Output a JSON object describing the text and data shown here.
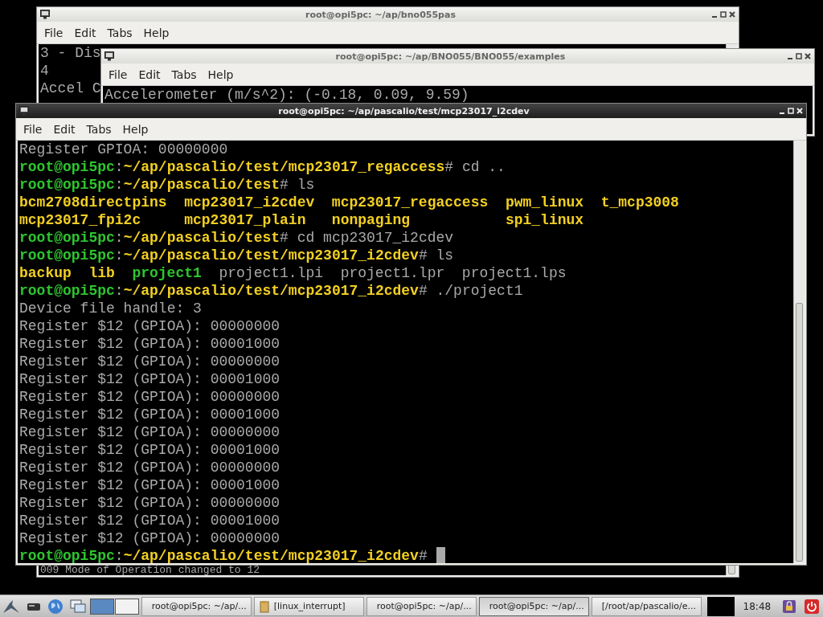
{
  "windows": [
    {
      "title": "root@opi5pc: ~/ap/bno055pas",
      "active": false,
      "menu": [
        "File",
        "Edit",
        "Tabs",
        "Help"
      ],
      "lines": [
        {
          "segments": [
            {
              "kind": "plain",
              "text": "3 - Dis"
            }
          ]
        },
        {
          "segments": [
            {
              "kind": "plain",
              "text": "4"
            }
          ]
        },
        {
          "segments": [
            {
              "kind": "plain",
              "text": "Accel C"
            }
          ]
        }
      ],
      "bottom_line": "009 Mode of Operation changed to 12"
    },
    {
      "title": "root@opi5pc: ~/ap/BNO055/BNO055/examples",
      "active": false,
      "menu": [
        "File",
        "Edit",
        "Tabs",
        "Help"
      ],
      "lines": [
        {
          "segments": [
            {
              "kind": "plain",
              "text": "Accelerometer (m/s^2): (-0.18, 0.09, 9.59)"
            }
          ]
        }
      ]
    },
    {
      "title": "root@opi5pc: ~/ap/pascalio/test/mcp23017_i2cdev",
      "active": true,
      "menu": [
        "File",
        "Edit",
        "Tabs",
        "Help"
      ],
      "cursor": true,
      "lines": [
        {
          "segments": [
            {
              "kind": "plain",
              "text": "Register GPIOA: 00000000"
            }
          ]
        },
        {
          "segments": [
            {
              "kind": "user",
              "text": "root@opi5pc"
            },
            {
              "kind": "plain",
              "text": ":"
            },
            {
              "kind": "path",
              "text": "~/ap/pascalio/test/mcp23017_regaccess"
            },
            {
              "kind": "plain",
              "text": "# cd .."
            }
          ]
        },
        {
          "segments": [
            {
              "kind": "user",
              "text": "root@opi5pc"
            },
            {
              "kind": "plain",
              "text": ":"
            },
            {
              "kind": "path",
              "text": "~/ap/pascalio/test"
            },
            {
              "kind": "plain",
              "text": "# ls"
            }
          ]
        },
        {
          "kind": "listing",
          "rows": [
            [
              {
                "kind": "dir",
                "text": "bcm2708directpins"
              },
              {
                "kind": "dir",
                "text": "mcp23017_i2cdev"
              },
              {
                "kind": "dir",
                "text": "mcp23017_regaccess"
              },
              {
                "kind": "dir",
                "text": "pwm_linux"
              },
              {
                "kind": "dir",
                "text": "t_mcp3008"
              }
            ],
            [
              {
                "kind": "dir",
                "text": "mcp23017_fpi2c"
              },
              {
                "kind": "dir",
                "text": "mcp23017_plain"
              },
              {
                "kind": "dir",
                "text": "nonpaging"
              },
              {
                "kind": "dir",
                "text": "spi_linux"
              }
            ]
          ]
        },
        {
          "segments": [
            {
              "kind": "user",
              "text": "root@opi5pc"
            },
            {
              "kind": "plain",
              "text": ":"
            },
            {
              "kind": "path",
              "text": "~/ap/pascalio/test"
            },
            {
              "kind": "plain",
              "text": "# cd mcp23017_i2cdev"
            }
          ]
        },
        {
          "segments": [
            {
              "kind": "user",
              "text": "root@opi5pc"
            },
            {
              "kind": "plain",
              "text": ":"
            },
            {
              "kind": "path",
              "text": "~/ap/pascalio/test/mcp23017_i2cdev"
            },
            {
              "kind": "plain",
              "text": "# ls"
            }
          ]
        },
        {
          "kind": "listing",
          "rows": [
            [
              {
                "kind": "dir",
                "text": "backup"
              },
              {
                "kind": "dir",
                "text": "lib"
              },
              {
                "kind": "exe",
                "text": "project1"
              },
              {
                "kind": "plain",
                "text": "project1.lpi"
              },
              {
                "kind": "plain",
                "text": "project1.lpr"
              },
              {
                "kind": "plain",
                "text": "project1.lps"
              }
            ]
          ]
        },
        {
          "segments": [
            {
              "kind": "user",
              "text": "root@opi5pc"
            },
            {
              "kind": "plain",
              "text": ":"
            },
            {
              "kind": "path",
              "text": "~/ap/pascalio/test/mcp23017_i2cdev"
            },
            {
              "kind": "plain",
              "text": "# ./project1"
            }
          ]
        },
        {
          "segments": [
            {
              "kind": "plain",
              "text": "Device file handle: 3"
            }
          ]
        },
        {
          "segments": [
            {
              "kind": "plain",
              "text": "Register $12 (GPIOA): 00000000"
            }
          ]
        },
        {
          "segments": [
            {
              "kind": "plain",
              "text": "Register $12 (GPIOA): 00001000"
            }
          ]
        },
        {
          "segments": [
            {
              "kind": "plain",
              "text": "Register $12 (GPIOA): 00000000"
            }
          ]
        },
        {
          "segments": [
            {
              "kind": "plain",
              "text": "Register $12 (GPIOA): 00001000"
            }
          ]
        },
        {
          "segments": [
            {
              "kind": "plain",
              "text": "Register $12 (GPIOA): 00000000"
            }
          ]
        },
        {
          "segments": [
            {
              "kind": "plain",
              "text": "Register $12 (GPIOA): 00001000"
            }
          ]
        },
        {
          "segments": [
            {
              "kind": "plain",
              "text": "Register $12 (GPIOA): 00000000"
            }
          ]
        },
        {
          "segments": [
            {
              "kind": "plain",
              "text": "Register $12 (GPIOA): 00001000"
            }
          ]
        },
        {
          "segments": [
            {
              "kind": "plain",
              "text": "Register $12 (GPIOA): 00000000"
            }
          ]
        },
        {
          "segments": [
            {
              "kind": "plain",
              "text": "Register $12 (GPIOA): 00001000"
            }
          ]
        },
        {
          "segments": [
            {
              "kind": "plain",
              "text": "Register $12 (GPIOA): 00000000"
            }
          ]
        },
        {
          "segments": [
            {
              "kind": "plain",
              "text": "Register $12 (GPIOA): 00001000"
            }
          ]
        },
        {
          "segments": [
            {
              "kind": "plain",
              "text": "Register $12 (GPIOA): 00000000"
            }
          ]
        },
        {
          "segments": [
            {
              "kind": "user",
              "text": "root@opi5pc"
            },
            {
              "kind": "plain",
              "text": ":"
            },
            {
              "kind": "path",
              "text": "~/ap/pascalio/test/mcp23017_i2cdev"
            },
            {
              "kind": "plain",
              "text": "# "
            }
          ]
        }
      ]
    }
  ],
  "taskbar": {
    "desktops": [
      {
        "selected": true
      },
      {
        "selected": false
      }
    ],
    "tasks": [
      {
        "kind": "terminal",
        "label": "root@opi5pc: ~/ap/...",
        "selected": false
      },
      {
        "kind": "folder",
        "label": "[linux_interrupt]",
        "selected": false
      },
      {
        "kind": "terminal",
        "label": "root@opi5pc: ~/ap/...",
        "selected": false
      },
      {
        "kind": "terminal",
        "label": "root@opi5pc: ~/ap/...",
        "selected": true
      },
      {
        "kind": "editor",
        "label": "[/root/ap/pascalio/e...",
        "selected": false
      }
    ],
    "clock": "18:48"
  }
}
